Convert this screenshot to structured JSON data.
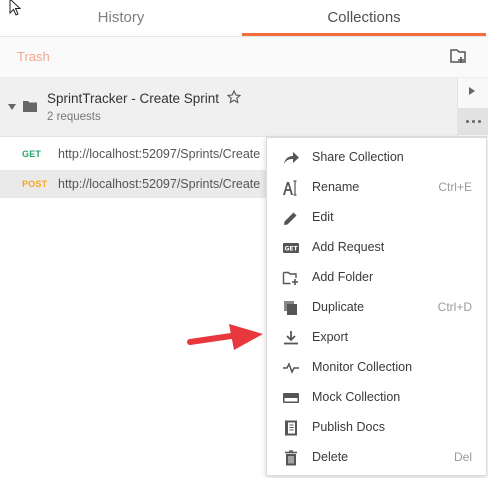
{
  "tabs": {
    "history": "History",
    "collections": "Collections"
  },
  "toolbar": {
    "trash": "Trash"
  },
  "collection": {
    "name": "SprintTracker - Create Sprint",
    "meta": "2 requests"
  },
  "requests": [
    {
      "method": "GET",
      "url": "http://localhost:52097/Sprints/Create"
    },
    {
      "method": "POST",
      "url": "http://localhost:52097/Sprints/Create"
    }
  ],
  "menu": {
    "items": [
      {
        "label": "Share Collection",
        "shortcut": ""
      },
      {
        "label": "Rename",
        "shortcut": "Ctrl+E"
      },
      {
        "label": "Edit",
        "shortcut": ""
      },
      {
        "label": "Add Request",
        "shortcut": ""
      },
      {
        "label": "Add Folder",
        "shortcut": ""
      },
      {
        "label": "Duplicate",
        "shortcut": "Ctrl+D"
      },
      {
        "label": "Export",
        "shortcut": ""
      },
      {
        "label": "Monitor Collection",
        "shortcut": ""
      },
      {
        "label": "Mock Collection",
        "shortcut": ""
      },
      {
        "label": "Publish Docs",
        "shortcut": ""
      },
      {
        "label": "Delete",
        "shortcut": "Del"
      }
    ],
    "get_badge": "GET"
  },
  "colors": {
    "accent": "#f26b3a",
    "get": "#2aa36b",
    "post": "#f5a623",
    "arrow": "#e8383d"
  }
}
